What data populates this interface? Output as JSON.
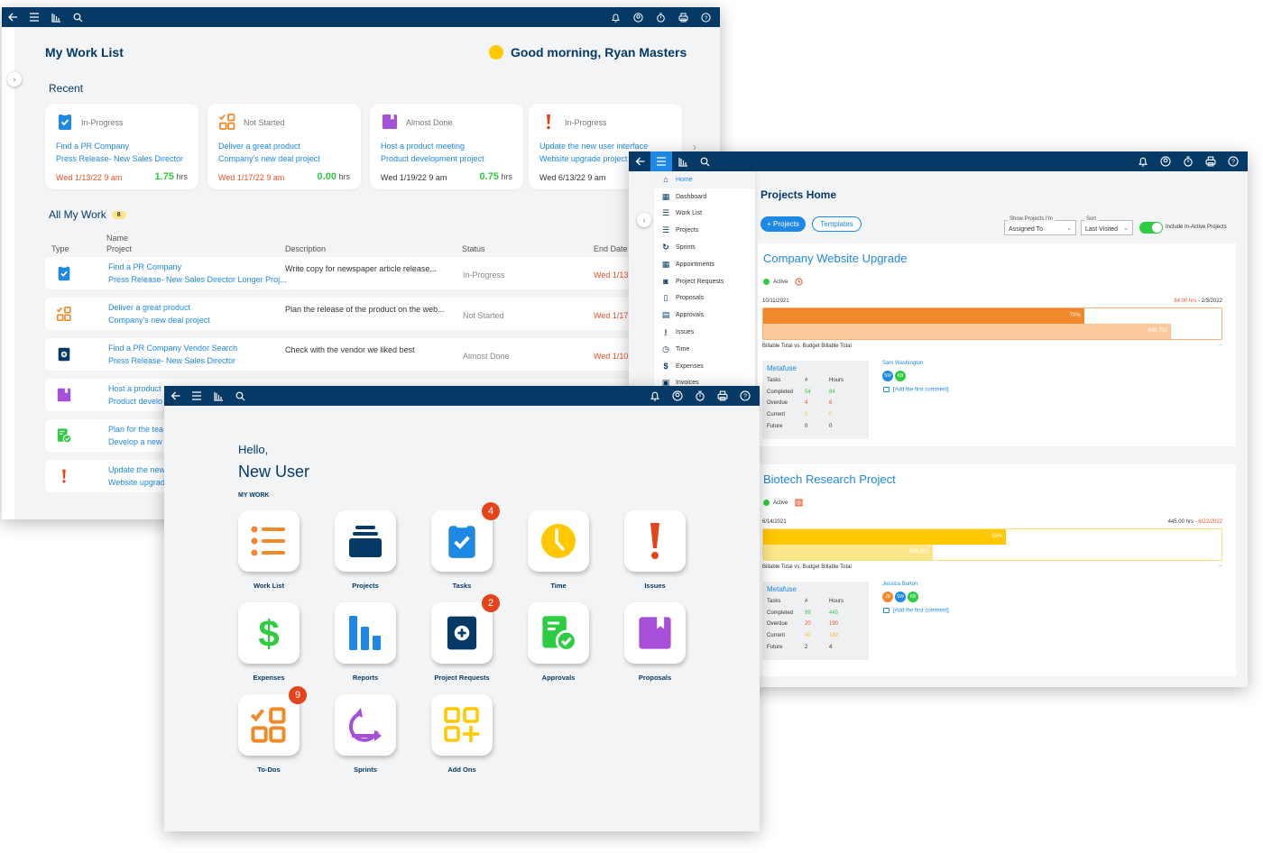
{
  "icons": {
    "back": "arrow-left-icon",
    "menu": "hamburger-menu-icon",
    "reports": "bar-chart-icon",
    "search": "search-icon",
    "bell": "bell-icon",
    "user": "user-circle-icon",
    "timer": "stopwatch-icon",
    "print": "printer-icon",
    "help": "help-circle-icon"
  },
  "worklist": {
    "title": "My Work List",
    "greeting": "Good morning, Ryan Masters",
    "recent_label": "Recent",
    "recent": [
      {
        "status": "In-Progress",
        "icon": "task-clipboard-icon",
        "name": "Find a PR Company",
        "project": "Press Release- New Sales Director",
        "date": "Wed 1/13/22 9 am",
        "date_color": "red",
        "hours": "1.75",
        "hours_unit": "hrs"
      },
      {
        "status": "Not Started",
        "icon": "todo-grid-icon",
        "name": "Deliver a great product",
        "project": "Company's new deal project",
        "date": "Wed 1/17/22 9 am",
        "date_color": "red",
        "hours": "0.00",
        "hours_unit": "hrs"
      },
      {
        "status": "Almost Done",
        "icon": "proposal-book-icon",
        "name": "Host a product meeting",
        "project": "Product development project",
        "date": "Wed 1/19/22 9 am",
        "date_color": "dark",
        "hours": "0.75",
        "hours_unit": "hrs"
      },
      {
        "status": "In-Progress",
        "icon": "issue-exclamation-icon",
        "name": "Update the new user interface",
        "project": "Website upgrade project",
        "date": "Wed 6/13/22 9 am",
        "date_color": "dark",
        "hours": "",
        "hours_unit": ""
      }
    ],
    "all_label": "All My Work",
    "all_count": "8",
    "columns": {
      "type": "Type",
      "name": "Name",
      "project": "Project",
      "description": "Description",
      "status": "Status",
      "end_date": "End Date"
    },
    "rows": [
      {
        "icon": "task-clipboard-icon",
        "name": "Find a PR Company",
        "project": "Press Release- New Sales Director Longer Proj...",
        "description": "Write copy for newspaper article release...",
        "status": "In-Progress",
        "end_date": "Wed 1/13"
      },
      {
        "icon": "todo-grid-icon",
        "name": "Deliver a great product",
        "project": "Company's new deal project",
        "description": "Plan the release of the product  on the web...",
        "status": "Not Started",
        "end_date": "Wed 1/17"
      },
      {
        "icon": "project-request-icon",
        "name": "Find a PR Company Vendor Search",
        "project": "Press Release- New Sales Director",
        "description": "Check with the vendor we liked best",
        "status": "Almost Done",
        "end_date": "Wed 1/10"
      },
      {
        "icon": "proposal-book-icon",
        "name": "Host a product",
        "project": "Product develo",
        "description": "",
        "status": "",
        "end_date": ""
      },
      {
        "icon": "approval-doc-icon",
        "name": "Plan for the tea",
        "project": "Develop a new y",
        "description": "",
        "status": "",
        "end_date": ""
      },
      {
        "icon": "issue-exclamation-icon",
        "name": "Update the new",
        "project": "Website upgrad",
        "description": "",
        "status": "",
        "end_date": ""
      }
    ]
  },
  "projects": {
    "title": "Projects Home",
    "add_button": "+ Projects",
    "templates_button": "Templates",
    "filter_label": "Show Projects I'm",
    "filter_value": "Assigned To",
    "sort_label": "Sort",
    "sort_value": "Last Visited",
    "toggle_label": "Include In-Active Projects",
    "toggle_on": true,
    "menu": [
      "Home",
      "Dashboard",
      "Work List",
      "Projects",
      "Sprints",
      "Appointments",
      "Project Requests",
      "Proposals",
      "Approvals",
      "Issues",
      "Time",
      "Expenses",
      "Invoices"
    ],
    "menu_active": "Home",
    "list": [
      {
        "name": "Company Website Upgrade",
        "status": "Active",
        "start": "10/11/2021",
        "hours": "84.00 hrs",
        "end": "2/3/2022",
        "progress_pct": 70,
        "progress_label": "70%",
        "billable_fraction": 0.89,
        "billable_label": "$45,752",
        "bar_caption": "Billable Total vs. Budget Billable Total",
        "more": "...",
        "company": "Metafuse",
        "stats_header": [
          "Tasks",
          "#",
          "Hours"
        ],
        "stats": [
          {
            "label": "Completed",
            "count": "54",
            "hours": "84"
          },
          {
            "label": "Overdue",
            "count": "4",
            "hours": "6"
          },
          {
            "label": "Current",
            "count": "0",
            "hours": "0"
          },
          {
            "label": "Future",
            "count": "0",
            "hours": "0"
          }
        ],
        "manager": "Sam Washington",
        "team": [
          {
            "initials": "SW",
            "color": "#1e88e5"
          },
          {
            "initials": "KB",
            "color": "#2ecc40"
          }
        ],
        "comment": "[Add the first comment]"
      },
      {
        "name": "Biotech Research Project",
        "status": "Active",
        "start": "6/14/2021",
        "hours": "445.00 hrs",
        "end": "6/22/2022",
        "progress_pct": 53,
        "progress_label": "53%",
        "billable_fraction": 0.37,
        "billable_label": "$49,331",
        "bar_caption": "Billable Total vs. Budget Billable Total",
        "more": "...",
        "company": "Metafuse",
        "stats_header": [
          "Tasks",
          "#",
          "Hours"
        ],
        "stats": [
          {
            "label": "Completed",
            "count": "99",
            "hours": "445"
          },
          {
            "label": "Overdue",
            "count": "20",
            "hours": "190"
          },
          {
            "label": "Current",
            "count": "40",
            "hours": "189"
          },
          {
            "label": "Future",
            "count": "2",
            "hours": "4"
          }
        ],
        "manager": "Jessica Burton",
        "team": [
          {
            "initials": "JB",
            "color": "#f0892a"
          },
          {
            "initials": "SW",
            "color": "#1e88e5"
          },
          {
            "initials": "KB",
            "color": "#2ecc40"
          }
        ],
        "comment": "[Add the first comment]"
      }
    ]
  },
  "home": {
    "hello": "Hello,",
    "user": "New User",
    "section": "MY WORK",
    "tiles": [
      {
        "label": "Work List",
        "icon": "work-list-icon",
        "badge": ""
      },
      {
        "label": "Projects",
        "icon": "projects-icon",
        "badge": ""
      },
      {
        "label": "Tasks",
        "icon": "tasks-icon",
        "badge": "4"
      },
      {
        "label": "Time",
        "icon": "time-clock-icon",
        "badge": ""
      },
      {
        "label": "Issues",
        "icon": "issues-icon",
        "badge": ""
      },
      {
        "label": "Expenses",
        "icon": "expenses-dollar-icon",
        "badge": ""
      },
      {
        "label": "Reports",
        "icon": "reports-icon",
        "badge": ""
      },
      {
        "label": "Project Requests",
        "icon": "project-requests-icon",
        "badge": "2"
      },
      {
        "label": "Approvals",
        "icon": "approvals-icon",
        "badge": ""
      },
      {
        "label": "Proposals",
        "icon": "proposals-icon",
        "badge": ""
      },
      {
        "label": "To-Dos",
        "icon": "todos-icon",
        "badge": "9"
      },
      {
        "label": "Sprints",
        "icon": "sprints-icon",
        "badge": ""
      },
      {
        "label": "Add Ons",
        "icon": "add-ons-icon",
        "badge": ""
      }
    ]
  },
  "colors": {
    "navy": "#053a66",
    "blue": "#1e88e5",
    "green": "#2ecc40",
    "red": "#f0502c",
    "orange": "#f0892a",
    "yellow": "#ffc800",
    "purple": "#a64fd9"
  }
}
